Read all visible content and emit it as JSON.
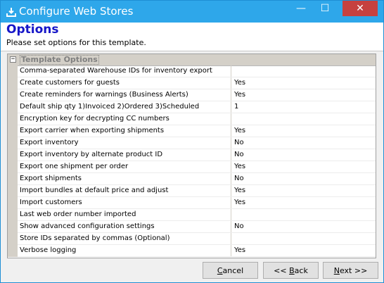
{
  "window": {
    "title": "Configure Web Stores",
    "controls": {
      "minimize": "—",
      "maximize": "☐",
      "close": "✕"
    }
  },
  "header": {
    "heading": "Options",
    "subtitle": "Please set options for this template."
  },
  "grid": {
    "category": "Template Options",
    "category_toggle": "−",
    "rows": [
      {
        "name": "Comma-separated Warehouse IDs for inventory export",
        "value": ""
      },
      {
        "name": "Create customers for guests",
        "value": "Yes"
      },
      {
        "name": "Create reminders for warnings (Business Alerts)",
        "value": "Yes"
      },
      {
        "name": "Default ship qty 1)Invoiced 2)Ordered 3)Scheduled",
        "value": "1"
      },
      {
        "name": "Encryption key for decrypting CC numbers",
        "value": ""
      },
      {
        "name": "Export carrier when exporting shipments",
        "value": "Yes"
      },
      {
        "name": "Export inventory",
        "value": "No"
      },
      {
        "name": "Export inventory by alternate product ID",
        "value": "No"
      },
      {
        "name": "Export one shipment per order",
        "value": "Yes"
      },
      {
        "name": "Export shipments",
        "value": "No"
      },
      {
        "name": "Import bundles at default price and adjust",
        "value": "Yes"
      },
      {
        "name": "Import customers",
        "value": "Yes"
      },
      {
        "name": "Last web order number imported",
        "value": ""
      },
      {
        "name": "Show advanced configuration settings",
        "value": "No"
      },
      {
        "name": "Store IDs separated by commas (Optional)",
        "value": ""
      },
      {
        "name": "Verbose logging",
        "value": "Yes"
      }
    ]
  },
  "buttons": {
    "cancel": {
      "accel": "C",
      "rest": "ancel"
    },
    "back": {
      "pre": "<< ",
      "accel": "B",
      "rest": "ack"
    },
    "next": {
      "accel": "N",
      "rest": "ext >>"
    }
  },
  "colors": {
    "titlebar": "#2ea7ea",
    "close_button": "#c6413f",
    "heading": "#1616c8"
  },
  "icons": {
    "app": "download-tray-icon"
  }
}
